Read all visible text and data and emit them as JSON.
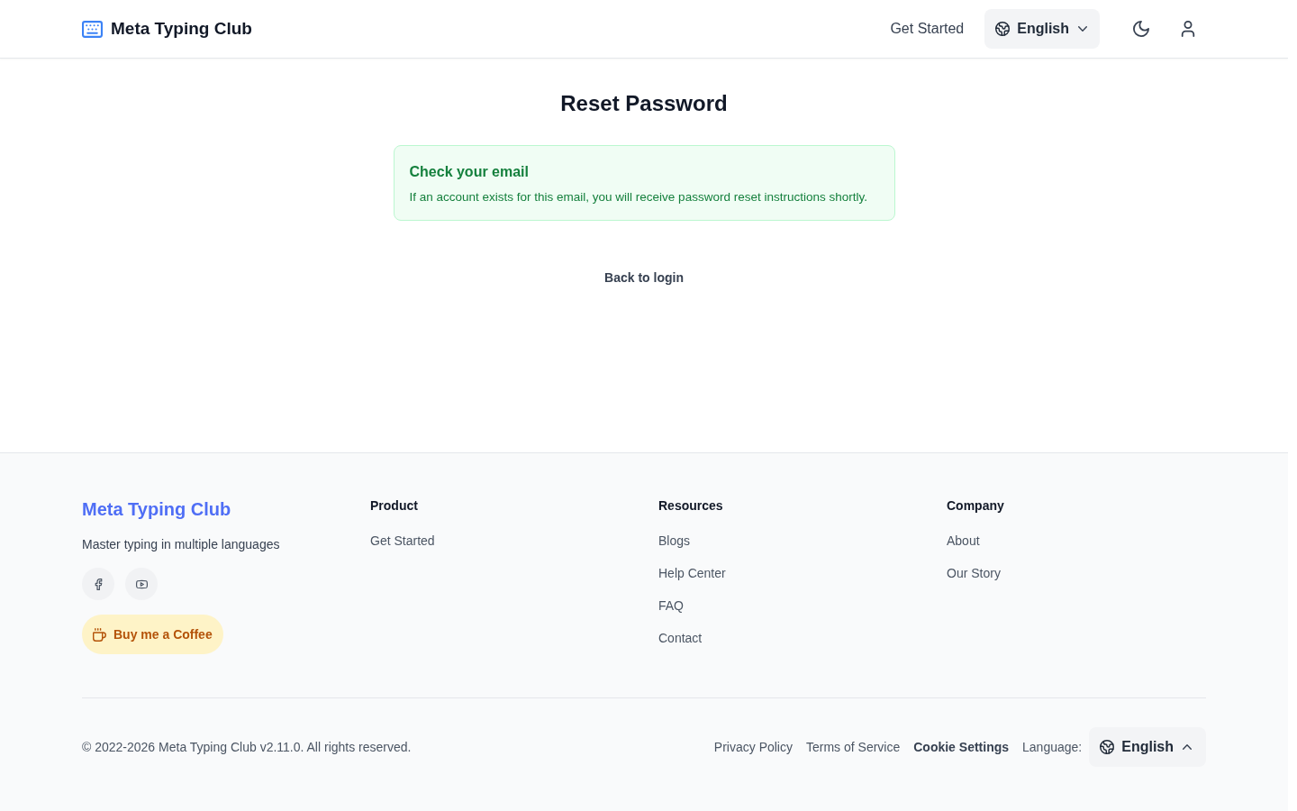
{
  "header": {
    "logo": "Meta Typing Club",
    "nav": [
      {
        "label": "Get Started"
      }
    ],
    "language": {
      "value": "English",
      "kind": "dropdown"
    },
    "actions": [
      {
        "kind": "theme"
      },
      {
        "kind": "account"
      }
    ]
  },
  "main": {
    "title": "Reset Password",
    "alert": {
      "kind": "success",
      "title": "Check your email",
      "message": "If an account exists for this email, you will receive password reset instructions shortly."
    },
    "back_link": "Back to login"
  },
  "footer": {
    "brand": "Meta Typing Club",
    "tagline": "Master typing in multiple languages",
    "socials": [
      {
        "kind": "facebook"
      },
      {
        "kind": "youtube"
      }
    ],
    "coffee_button": "Buy me a Coffee",
    "columns": [
      {
        "heading": "Product",
        "links": [
          "Get Started"
        ]
      },
      {
        "heading": "Resources",
        "links": [
          "Blogs",
          "Help Center",
          "FAQ",
          "Contact"
        ]
      },
      {
        "heading": "Company",
        "links": [
          "About",
          "Our Story"
        ]
      }
    ],
    "copyright": "© 2022-2026 Meta Typing Club v2.11.0. All rights reserved.",
    "legal_links": [
      {
        "label": "Privacy Policy",
        "kind": "link"
      },
      {
        "label": "Terms of Service",
        "kind": "link"
      },
      {
        "label": "Cookie Settings",
        "kind": "button"
      }
    ],
    "language": {
      "label": "Language:",
      "value": "English",
      "kind": "dropup"
    }
  }
}
